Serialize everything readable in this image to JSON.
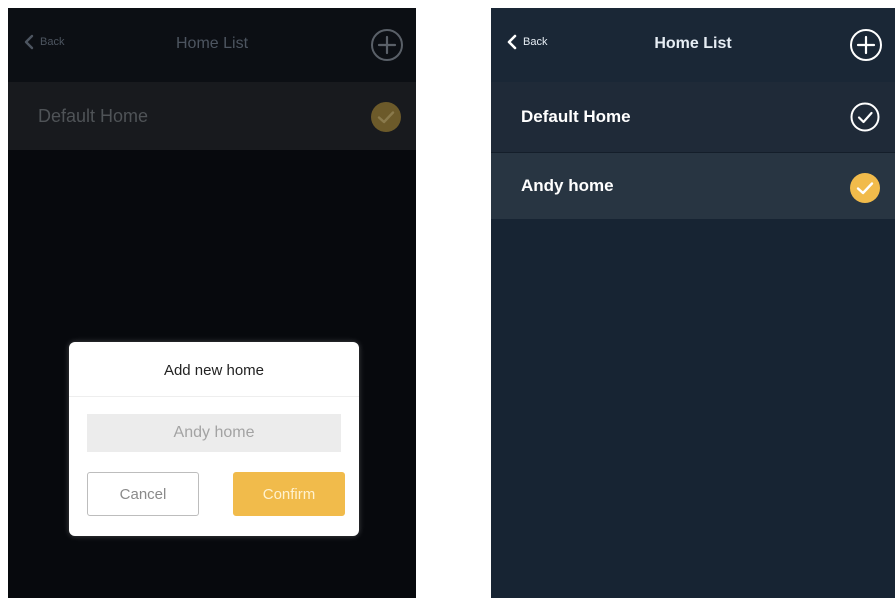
{
  "left_screen": {
    "navbar": {
      "back_label": "Back",
      "title": "Home List",
      "add_icon": "plus-circle-icon"
    },
    "homes": [
      {
        "label": "Default Home",
        "selected": true
      }
    ],
    "dialog": {
      "title": "Add new home",
      "input_value": "Andy home",
      "cancel_label": "Cancel",
      "confirm_label": "Confirm"
    }
  },
  "right_screen": {
    "navbar": {
      "back_label": "Back",
      "title": "Home List",
      "add_icon": "plus-circle-icon"
    },
    "homes": [
      {
        "label": "Default Home",
        "selected": false
      },
      {
        "label": "Andy home",
        "selected": true
      }
    ]
  },
  "colors": {
    "accent": "#f1bb4b",
    "left_bg": "#07090d",
    "right_bg": "#172433"
  }
}
